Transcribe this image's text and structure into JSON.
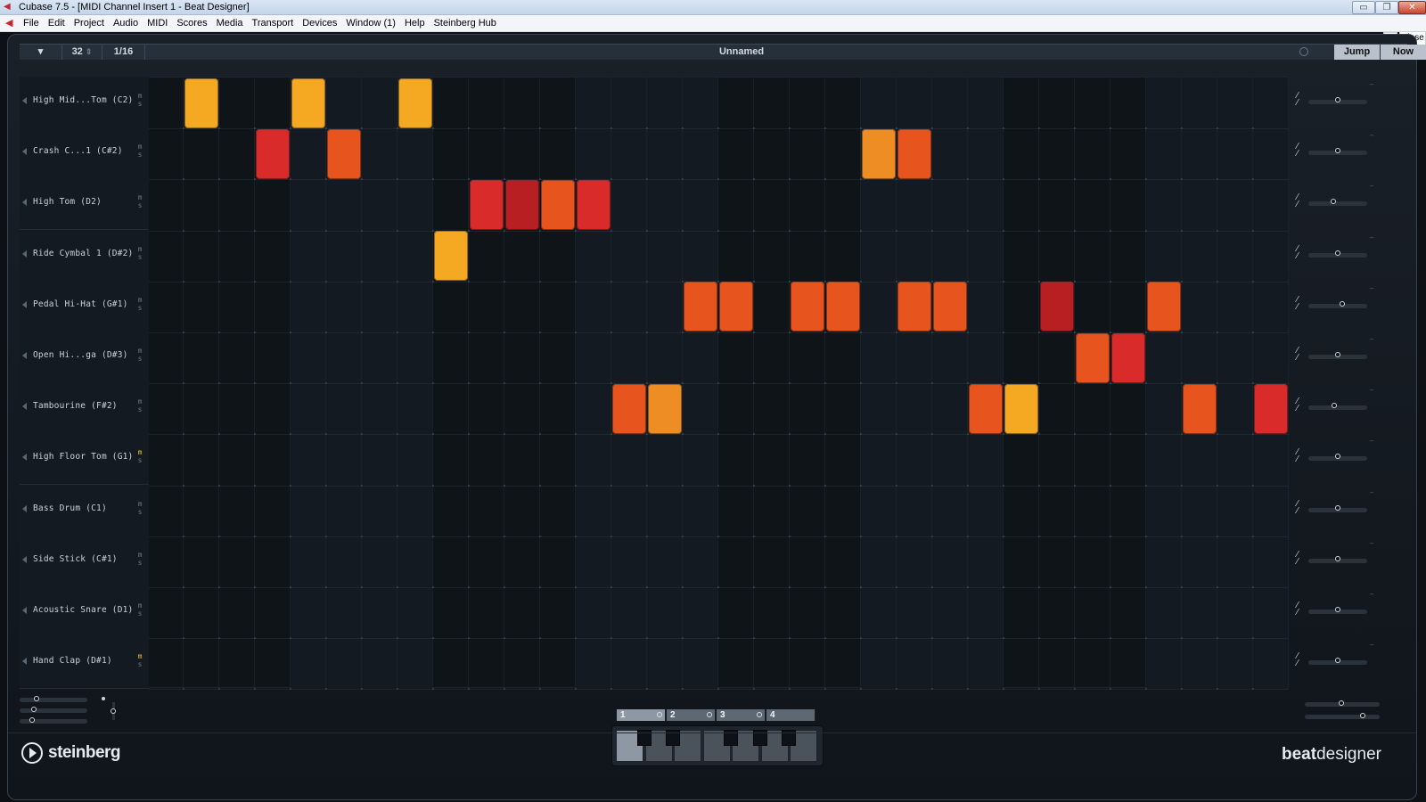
{
  "window": {
    "title": "Cubase 7.5 - [MIDI Channel Insert 1 - Beat Designer]",
    "min": "▭",
    "max": "❐",
    "close": "✕",
    "mdi_min": "_",
    "mdi_close": "Close"
  },
  "menu": [
    "File",
    "Edit",
    "Project",
    "Audio",
    "MIDI",
    "Scores",
    "Media",
    "Transport",
    "Devices",
    "Window (1)",
    "Help",
    "Steinberg Hub"
  ],
  "toolbar": {
    "dropdown": "▾",
    "steps": "32",
    "steps_arrows": "⇕",
    "resolution": "1/16",
    "pattern_name": "Unnamed",
    "jump": "Jump",
    "now": "Now"
  },
  "colors": {
    "yellow": "#f0a520",
    "orange": "#e98a22",
    "orange_red": "#e2521d",
    "red": "#d62a2a",
    "dark_red": "#b41e22",
    "mute_on": "#f2c230"
  },
  "lanes": [
    {
      "name": "High Mid...Tom (C2)",
      "mute_on": false,
      "swing": 0.5
    },
    {
      "name": "Crash C...1 (C#2)",
      "mute_on": false,
      "swing": 0.5
    },
    {
      "name": "High Tom (D2)",
      "mute_on": false,
      "swing": 0.42
    },
    {
      "name": "Ride Cymbal 1 (D#2)",
      "mute_on": false,
      "swing": 0.5
    },
    {
      "name": "Pedal Hi-Hat (G#1)",
      "mute_on": false,
      "swing": 0.58
    },
    {
      "name": "Open Hi...ga (D#3)",
      "mute_on": false,
      "swing": 0.5
    },
    {
      "name": "Tambourine (F#2)",
      "mute_on": false,
      "swing": 0.44
    },
    {
      "name": "High Floor Tom (G1)",
      "mute_on": true,
      "swing": 0.5
    },
    {
      "name": "Bass Drum (C1)",
      "mute_on": false,
      "swing": 0.5
    },
    {
      "name": "Side Stick (C#1)",
      "mute_on": false,
      "swing": 0.5
    },
    {
      "name": "Acoustic Snare (D1)",
      "mute_on": false,
      "swing": 0.5
    },
    {
      "name": "Hand Clap (D#1)",
      "mute_on": true,
      "swing": 0.5
    }
  ],
  "steps": [
    {
      "lane": 0,
      "step": 1,
      "color": "yellow"
    },
    {
      "lane": 0,
      "step": 4,
      "color": "yellow"
    },
    {
      "lane": 0,
      "step": 7,
      "color": "yellow"
    },
    {
      "lane": 1,
      "step": 3,
      "color": "red"
    },
    {
      "lane": 1,
      "step": 5,
      "color": "orange_red"
    },
    {
      "lane": 1,
      "step": 20,
      "color": "orange"
    },
    {
      "lane": 1,
      "step": 21,
      "color": "orange_red"
    },
    {
      "lane": 2,
      "step": 9,
      "color": "red"
    },
    {
      "lane": 2,
      "step": 10,
      "color": "dark_red"
    },
    {
      "lane": 2,
      "step": 11,
      "color": "orange_red"
    },
    {
      "lane": 2,
      "step": 12,
      "color": "red"
    },
    {
      "lane": 3,
      "step": 8,
      "color": "yellow"
    },
    {
      "lane": 4,
      "step": 15,
      "color": "orange_red"
    },
    {
      "lane": 4,
      "step": 16,
      "color": "orange_red"
    },
    {
      "lane": 4,
      "step": 18,
      "color": "orange_red"
    },
    {
      "lane": 4,
      "step": 19,
      "color": "orange_red"
    },
    {
      "lane": 4,
      "step": 21,
      "color": "orange_red"
    },
    {
      "lane": 4,
      "step": 22,
      "color": "orange_red"
    },
    {
      "lane": 4,
      "step": 25,
      "color": "dark_red"
    },
    {
      "lane": 4,
      "step": 28,
      "color": "orange_red"
    },
    {
      "lane": 5,
      "step": 26,
      "color": "orange_red"
    },
    {
      "lane": 5,
      "step": 27,
      "color": "red"
    },
    {
      "lane": 6,
      "step": 13,
      "color": "orange_red"
    },
    {
      "lane": 6,
      "step": 14,
      "color": "orange"
    },
    {
      "lane": 6,
      "step": 23,
      "color": "orange_red"
    },
    {
      "lane": 6,
      "step": 24,
      "color": "yellow"
    },
    {
      "lane": 6,
      "step": 29,
      "color": "orange_red"
    },
    {
      "lane": 6,
      "step": 31,
      "color": "red"
    }
  ],
  "bars": [
    "1",
    "2",
    "3",
    "4"
  ],
  "active_bar": 0,
  "brand": {
    "steinberg": "steinberg",
    "beat": "beat",
    "designer": "designer"
  }
}
